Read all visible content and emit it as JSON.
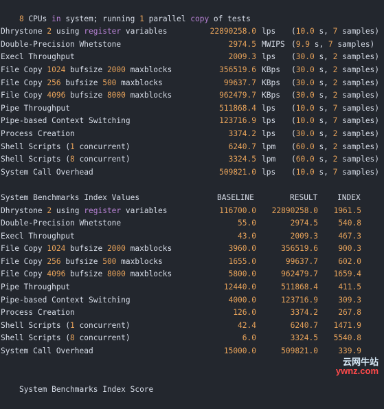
{
  "header": {
    "p1": "",
    "n1": "8",
    "p2": " CPUs ",
    "k1": "in",
    "p3": " system; running ",
    "n2": "1",
    "p4": " parallel ",
    "k2": "copy",
    "p5": " of tests"
  },
  "results": [
    {
      "name": [
        {
          "t": "Dhrystone "
        },
        {
          "t": "2",
          "s": "num"
        },
        {
          "t": " using "
        },
        {
          "t": "register",
          "s": "kw"
        },
        {
          "t": " variables"
        }
      ],
      "value": "22890258.0",
      "unit": "lps",
      "detail": [
        {
          "t": "("
        },
        {
          "t": "10.0",
          "s": "num"
        },
        {
          "t": " s, "
        },
        {
          "t": "7",
          "s": "num"
        },
        {
          "t": " samples)"
        }
      ]
    },
    {
      "name": [
        {
          "t": "Double-Precision Whetstone"
        }
      ],
      "value": "2974.5",
      "unit": "MWIPS",
      "detail": [
        {
          "t": "("
        },
        {
          "t": "9.9",
          "s": "num"
        },
        {
          "t": " s, "
        },
        {
          "t": "7",
          "s": "num"
        },
        {
          "t": " samples)"
        }
      ]
    },
    {
      "name": [
        {
          "t": "Execl Throughput"
        }
      ],
      "value": "2009.3",
      "unit": "lps",
      "detail": [
        {
          "t": "("
        },
        {
          "t": "30.0",
          "s": "num"
        },
        {
          "t": " s, "
        },
        {
          "t": "2",
          "s": "num"
        },
        {
          "t": " samples)"
        }
      ]
    },
    {
      "name": [
        {
          "t": "File Copy "
        },
        {
          "t": "1024",
          "s": "num"
        },
        {
          "t": " bufsize "
        },
        {
          "t": "2000",
          "s": "num"
        },
        {
          "t": " maxblocks"
        }
      ],
      "value": "356519.6",
      "unit": "KBps",
      "detail": [
        {
          "t": "("
        },
        {
          "t": "30.0",
          "s": "num"
        },
        {
          "t": " s, "
        },
        {
          "t": "2",
          "s": "num"
        },
        {
          "t": " samples)"
        }
      ]
    },
    {
      "name": [
        {
          "t": "File Copy "
        },
        {
          "t": "256",
          "s": "num"
        },
        {
          "t": " bufsize "
        },
        {
          "t": "500",
          "s": "num"
        },
        {
          "t": " maxblocks"
        }
      ],
      "value": "99637.7",
      "unit": "KBps",
      "detail": [
        {
          "t": "("
        },
        {
          "t": "30.0",
          "s": "num"
        },
        {
          "t": " s, "
        },
        {
          "t": "2",
          "s": "num"
        },
        {
          "t": " samples)"
        }
      ]
    },
    {
      "name": [
        {
          "t": "File Copy "
        },
        {
          "t": "4096",
          "s": "num"
        },
        {
          "t": " bufsize "
        },
        {
          "t": "8000",
          "s": "num"
        },
        {
          "t": " maxblocks"
        }
      ],
      "value": "962479.7",
      "unit": "KBps",
      "detail": [
        {
          "t": "("
        },
        {
          "t": "30.0",
          "s": "num"
        },
        {
          "t": " s, "
        },
        {
          "t": "2",
          "s": "num"
        },
        {
          "t": " samples)"
        }
      ]
    },
    {
      "name": [
        {
          "t": "Pipe Throughput"
        }
      ],
      "value": "511868.4",
      "unit": "lps",
      "detail": [
        {
          "t": "("
        },
        {
          "t": "10.0",
          "s": "num"
        },
        {
          "t": " s, "
        },
        {
          "t": "7",
          "s": "num"
        },
        {
          "t": " samples)"
        }
      ]
    },
    {
      "name": [
        {
          "t": "Pipe-based Context Switching"
        }
      ],
      "value": "123716.9",
      "unit": "lps",
      "detail": [
        {
          "t": "("
        },
        {
          "t": "10.0",
          "s": "num"
        },
        {
          "t": " s, "
        },
        {
          "t": "7",
          "s": "num"
        },
        {
          "t": " samples)"
        }
      ]
    },
    {
      "name": [
        {
          "t": "Process Creation"
        }
      ],
      "value": "3374.2",
      "unit": "lps",
      "detail": [
        {
          "t": "("
        },
        {
          "t": "30.0",
          "s": "num"
        },
        {
          "t": " s, "
        },
        {
          "t": "2",
          "s": "num"
        },
        {
          "t": " samples)"
        }
      ]
    },
    {
      "name": [
        {
          "t": "Shell Scripts ("
        },
        {
          "t": "1",
          "s": "num"
        },
        {
          "t": " concurrent)"
        }
      ],
      "value": "6240.7",
      "unit": "lpm",
      "detail": [
        {
          "t": "("
        },
        {
          "t": "60.0",
          "s": "num"
        },
        {
          "t": " s, "
        },
        {
          "t": "2",
          "s": "num"
        },
        {
          "t": " samples)"
        }
      ]
    },
    {
      "name": [
        {
          "t": "Shell Scripts ("
        },
        {
          "t": "8",
          "s": "num"
        },
        {
          "t": " concurrent)"
        }
      ],
      "value": "3324.5",
      "unit": "lpm",
      "detail": [
        {
          "t": "("
        },
        {
          "t": "60.0",
          "s": "num"
        },
        {
          "t": " s, "
        },
        {
          "t": "2",
          "s": "num"
        },
        {
          "t": " samples)"
        }
      ]
    },
    {
      "name": [
        {
          "t": "System Call Overhead"
        }
      ],
      "value": "509821.0",
      "unit": "lps",
      "detail": [
        {
          "t": "("
        },
        {
          "t": "10.0",
          "s": "num"
        },
        {
          "t": " s, "
        },
        {
          "t": "7",
          "s": "num"
        },
        {
          "t": " samples)"
        }
      ]
    }
  ],
  "index_table": {
    "title": "System Benchmarks Index Values",
    "col_baseline": "BASELINE",
    "col_result": "RESULT",
    "col_index": "INDEX",
    "rows": [
      {
        "name": [
          {
            "t": "Dhrystone "
          },
          {
            "t": "2",
            "s": "num"
          },
          {
            "t": " using "
          },
          {
            "t": "register",
            "s": "kw"
          },
          {
            "t": " variables"
          }
        ],
        "baseline": "116700.0",
        "result": "22890258.0",
        "index": "1961.5"
      },
      {
        "name": [
          {
            "t": "Double-Precision Whetstone"
          }
        ],
        "baseline": "55.0",
        "result": "2974.5",
        "index": "540.8"
      },
      {
        "name": [
          {
            "t": "Execl Throughput"
          }
        ],
        "baseline": "43.0",
        "result": "2009.3",
        "index": "467.3"
      },
      {
        "name": [
          {
            "t": "File Copy "
          },
          {
            "t": "1024",
            "s": "num"
          },
          {
            "t": " bufsize "
          },
          {
            "t": "2000",
            "s": "num"
          },
          {
            "t": " maxblocks"
          }
        ],
        "baseline": "3960.0",
        "result": "356519.6",
        "index": "900.3"
      },
      {
        "name": [
          {
            "t": "File Copy "
          },
          {
            "t": "256",
            "s": "num"
          },
          {
            "t": " bufsize "
          },
          {
            "t": "500",
            "s": "num"
          },
          {
            "t": " maxblocks"
          }
        ],
        "baseline": "1655.0",
        "result": "99637.7",
        "index": "602.0"
      },
      {
        "name": [
          {
            "t": "File Copy "
          },
          {
            "t": "4096",
            "s": "num"
          },
          {
            "t": " bufsize "
          },
          {
            "t": "8000",
            "s": "num"
          },
          {
            "t": " maxblocks"
          }
        ],
        "baseline": "5800.0",
        "result": "962479.7",
        "index": "1659.4"
      },
      {
        "name": [
          {
            "t": "Pipe Throughput"
          }
        ],
        "baseline": "12440.0",
        "result": "511868.4",
        "index": "411.5"
      },
      {
        "name": [
          {
            "t": "Pipe-based Context Switching"
          }
        ],
        "baseline": "4000.0",
        "result": "123716.9",
        "index": "309.3"
      },
      {
        "name": [
          {
            "t": "Process Creation"
          }
        ],
        "baseline": "126.0",
        "result": "3374.2",
        "index": "267.8"
      },
      {
        "name": [
          {
            "t": "Shell Scripts ("
          },
          {
            "t": "1",
            "s": "num"
          },
          {
            "t": " concurrent)"
          }
        ],
        "baseline": "42.4",
        "result": "6240.7",
        "index": "1471.9"
      },
      {
        "name": [
          {
            "t": "Shell Scripts ("
          },
          {
            "t": "8",
            "s": "num"
          },
          {
            "t": " concurrent)"
          }
        ],
        "baseline": "6.0",
        "result": "3324.5",
        "index": "5540.8"
      },
      {
        "name": [
          {
            "t": "System Call Overhead"
          }
        ],
        "baseline": "15000.0",
        "result": "509821.0",
        "index": "339.9"
      }
    ]
  },
  "score_label": "System Benchmarks Index Score",
  "watermark": {
    "line1": "云网牛站",
    "line2": "ywnz.com"
  },
  "colors": {
    "background": "#23272e",
    "text": "#d8dee9",
    "number": "#e8a35a",
    "keyword": "#b983d6"
  }
}
